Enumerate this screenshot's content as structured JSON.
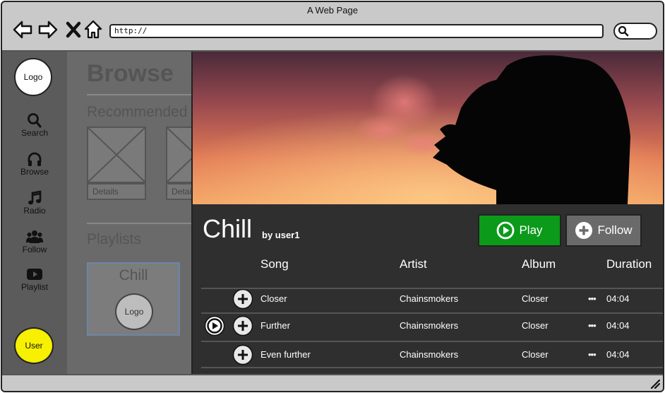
{
  "window": {
    "title": "A Web Page"
  },
  "browser": {
    "url": "http://",
    "buttons": [
      "back-icon",
      "forward-icon",
      "close-icon",
      "home-icon"
    ],
    "search_icon": "search-icon"
  },
  "sidebar": {
    "logo": "Logo",
    "items": [
      {
        "label": "Search",
        "icon": "search-icon"
      },
      {
        "label": "Browse",
        "icon": "headphones-icon"
      },
      {
        "label": "Radio",
        "icon": "music-note-icon"
      },
      {
        "label": "Follow",
        "icon": "users-icon"
      },
      {
        "label": "Playlist",
        "icon": "youtube-play-icon"
      }
    ],
    "user": "User",
    "user_color": "#f7f000"
  },
  "browse": {
    "title": "Browse",
    "recommended": "Recommended",
    "details": [
      "Details",
      "Details"
    ],
    "playlists_title": "Playlists",
    "playlist_card": {
      "name": "Chill",
      "logo": "Logo"
    }
  },
  "playlist": {
    "name": "Chill",
    "by": "by user1",
    "play_label": "Play",
    "follow_label": "Follow",
    "play_color": "#0b9a1a",
    "columns": [
      "Song",
      "Artist",
      "Album",
      "Duration"
    ],
    "tracks": [
      {
        "song": "Closer",
        "artist": "Chainsmokers",
        "album": "Closer",
        "more": "•••",
        "duration": "04:04"
      },
      {
        "song": "Further",
        "artist": "Chainsmokers",
        "album": "Closer",
        "more": "•••",
        "duration": "04:04"
      },
      {
        "song": "Even further",
        "artist": "Chainsmokers",
        "album": "Closer",
        "more": "•••",
        "duration": "04:04"
      }
    ]
  }
}
